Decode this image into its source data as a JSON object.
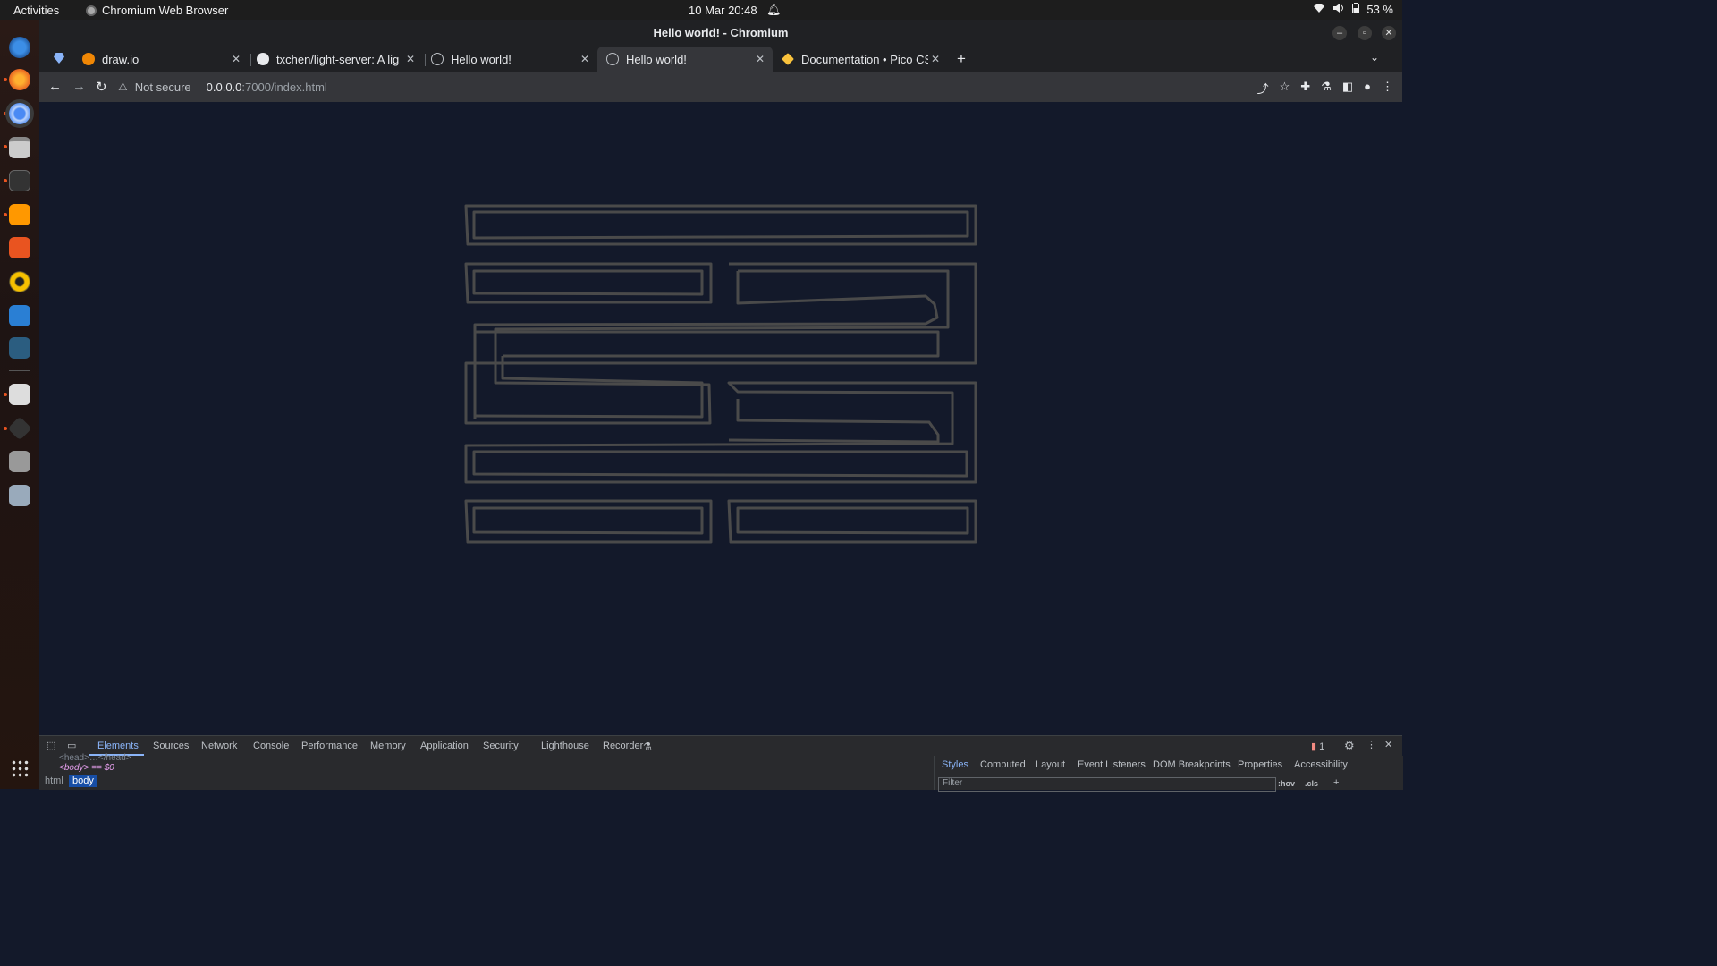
{
  "system_bar": {
    "activities": "Activities",
    "app_name": "Chromium Web Browser",
    "clock": "10 Mar  20:48",
    "battery": "53 %"
  },
  "window": {
    "title": "Hello world! - Chromium"
  },
  "tabs": [
    {
      "label": "draw.io",
      "active": false
    },
    {
      "label": "txchen/light-server: A lig",
      "active": false
    },
    {
      "label": "Hello world!",
      "active": false
    },
    {
      "label": "Hello world!",
      "active": true
    },
    {
      "label": "Documentation • Pico CS",
      "active": false
    }
  ],
  "omnibox": {
    "security": "Not secure",
    "host": "0.0.0.0",
    "path": ":7000/index.html"
  },
  "devtools": {
    "tabs": [
      "Elements",
      "Sources",
      "Network",
      "Console",
      "Performance",
      "Memory",
      "Application",
      "Security",
      "Lighthouse",
      "Recorder"
    ],
    "active_tab": "Elements",
    "issue_count": "1",
    "dom_line_head": "<head>…</head>",
    "dom_line_body": "<body> == $0",
    "breadcrumbs": [
      "html",
      "body"
    ],
    "side_tabs": [
      "Styles",
      "Computed",
      "Layout",
      "Event Listeners",
      "DOM Breakpoints",
      "Properties",
      "Accessibility"
    ],
    "filter_placeholder": "Filter",
    "hov": ":hov",
    "cls": ".cls"
  },
  "colors": {
    "page_bg": "#13192a",
    "logo_stroke": "#4a4a4a",
    "accent": "#8ab4f8"
  }
}
